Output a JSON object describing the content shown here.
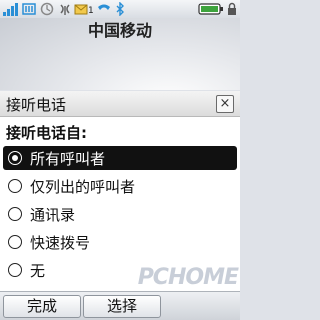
{
  "status": {
    "battery_color": "#3da33d",
    "signal_color": "#2a8fd6",
    "icons": [
      "signal-bars-icon",
      "network-icon",
      "sync-icon",
      "message-icon",
      "call-icon",
      "bluetooth-icon",
      "battery-icon"
    ],
    "message_count": "1"
  },
  "carrier": "中国移动",
  "dialog": {
    "title": "接听电话",
    "close_label": "×",
    "prompt": "接听电话自:",
    "options": [
      {
        "label": "所有呼叫者",
        "selected": true
      },
      {
        "label": "仅列出的呼叫者",
        "selected": false
      },
      {
        "label": "通讯录",
        "selected": false
      },
      {
        "label": "快速拨号",
        "selected": false
      },
      {
        "label": "无",
        "selected": false
      }
    ]
  },
  "softkeys": {
    "left": "完成",
    "right": "选择"
  },
  "watermark": "PCHOME"
}
